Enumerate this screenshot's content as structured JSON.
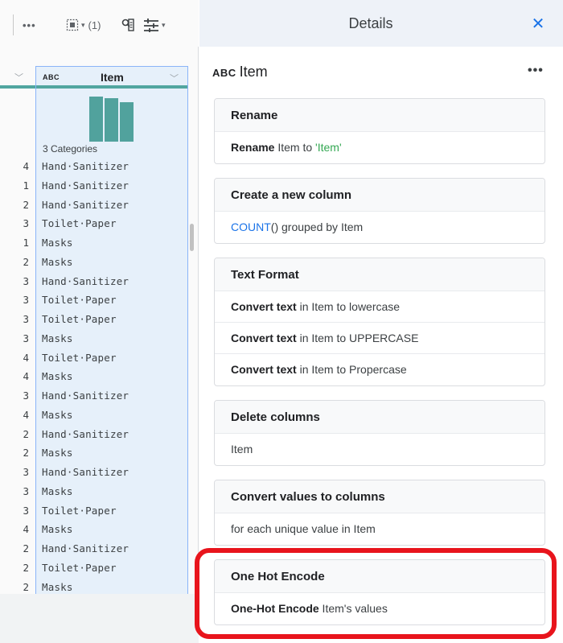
{
  "toolbar": {
    "more_icon": "more-horizontal-icon",
    "selected_count": "(1)",
    "find_icon": "find-in-column-icon",
    "tune_icon": "tune-icon"
  },
  "column": {
    "type_badge": "ABC",
    "name": "Item",
    "histogram_values": [
      100,
      96,
      88
    ],
    "categories_label": "3 Categories"
  },
  "rows": [
    {
      "num": "4",
      "val": "Hand·Sanitizer"
    },
    {
      "num": "1",
      "val": "Hand·Sanitizer"
    },
    {
      "num": "2",
      "val": "Hand·Sanitizer"
    },
    {
      "num": "3",
      "val": "Toilet·Paper"
    },
    {
      "num": "1",
      "val": "Masks"
    },
    {
      "num": "2",
      "val": "Masks"
    },
    {
      "num": "3",
      "val": "Hand·Sanitizer"
    },
    {
      "num": "3",
      "val": "Toilet·Paper"
    },
    {
      "num": "3",
      "val": "Toilet·Paper"
    },
    {
      "num": "3",
      "val": "Masks"
    },
    {
      "num": "4",
      "val": "Toilet·Paper"
    },
    {
      "num": "4",
      "val": "Masks"
    },
    {
      "num": "3",
      "val": "Hand·Sanitizer"
    },
    {
      "num": "4",
      "val": "Masks"
    },
    {
      "num": "2",
      "val": "Hand·Sanitizer"
    },
    {
      "num": "2",
      "val": "Masks"
    },
    {
      "num": "3",
      "val": "Hand·Sanitizer"
    },
    {
      "num": "3",
      "val": "Masks"
    },
    {
      "num": "3",
      "val": "Toilet·Paper"
    },
    {
      "num": "4",
      "val": "Masks"
    },
    {
      "num": "2",
      "val": "Hand·Sanitizer"
    },
    {
      "num": "2",
      "val": "Toilet·Paper"
    },
    {
      "num": "2",
      "val": "Masks"
    }
  ],
  "details": {
    "title": "Details",
    "close_icon": "close-icon",
    "column_badge": "ABC",
    "column_name": "Item",
    "kebab": "•••"
  },
  "cards": {
    "rename": {
      "title": "Rename",
      "row_bold": "Rename",
      "row_mid": " Item to ",
      "row_quoted": "'Item'"
    },
    "new_column": {
      "title": "Create a new column",
      "row_link": "COUNT",
      "row_rest": "() grouped by Item"
    },
    "text_format": {
      "title": "Text Format",
      "rows": [
        {
          "bold": "Convert text",
          "rest": " in Item to lowercase"
        },
        {
          "bold": "Convert text",
          "rest": " in Item to UPPERCASE"
        },
        {
          "bold": "Convert text",
          "rest": " in Item to Propercase"
        }
      ]
    },
    "delete": {
      "title": "Delete columns",
      "row": "Item"
    },
    "values_to_columns": {
      "title": "Convert values to columns",
      "row": "for each unique value in Item"
    },
    "one_hot": {
      "title": "One Hot Encode",
      "row_bold": "One-Hot Encode",
      "row_rest": " Item's values"
    }
  },
  "colors": {
    "accent_teal": "#51a29d",
    "link_blue": "#1a73e8",
    "highlight_red": "#e8141c",
    "selected_col_bg": "#e6f0fa"
  }
}
